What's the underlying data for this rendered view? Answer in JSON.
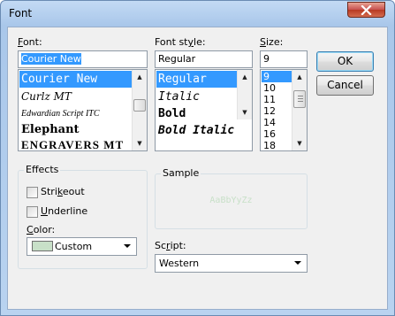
{
  "window": {
    "title": "Font"
  },
  "font": {
    "label_pre": "",
    "label_accel": "F",
    "label_post": "ont:",
    "value": "Courier New",
    "items": [
      {
        "label": "Courier New",
        "selected": true
      },
      {
        "label": "Curlz MT",
        "selected": false
      },
      {
        "label": "Edwardian Script ITC",
        "selected": false
      },
      {
        "label": "Elephant",
        "selected": false
      },
      {
        "label": "ENGRAVERS MT",
        "selected": false
      }
    ]
  },
  "style": {
    "label_pre": "Font st",
    "label_accel": "y",
    "label_post": "le:",
    "value": "Regular",
    "items": [
      {
        "label": "Regular",
        "selected": true
      },
      {
        "label": "Italic",
        "selected": false
      },
      {
        "label": "Bold",
        "selected": false
      },
      {
        "label": "Bold Italic",
        "selected": false
      }
    ]
  },
  "size": {
    "label_pre": "",
    "label_accel": "S",
    "label_post": "ize:",
    "value": "9",
    "items": [
      {
        "label": "9",
        "selected": true
      },
      {
        "label": "10",
        "selected": false
      },
      {
        "label": "11",
        "selected": false
      },
      {
        "label": "12",
        "selected": false
      },
      {
        "label": "14",
        "selected": false
      },
      {
        "label": "16",
        "selected": false
      },
      {
        "label": "18",
        "selected": false
      }
    ]
  },
  "buttons": {
    "ok": "OK",
    "cancel": "Cancel"
  },
  "effects": {
    "title": "Effects",
    "strikeout": {
      "pre": "Stri",
      "accel": "k",
      "post": "eout",
      "checked": false
    },
    "underline": {
      "pre": "",
      "accel": "U",
      "post": "nderline",
      "checked": false
    },
    "color_label_pre": "",
    "color_label_accel": "C",
    "color_label_post": "olor:",
    "color_value": "Custom",
    "color_swatch": "#c8e0c8"
  },
  "sample": {
    "title": "Sample",
    "text": "AaBbYyZz",
    "text_color": "#c8e0c8"
  },
  "script": {
    "label_pre": "Sc",
    "label_accel": "r",
    "label_post": "ipt:",
    "value": "Western"
  }
}
